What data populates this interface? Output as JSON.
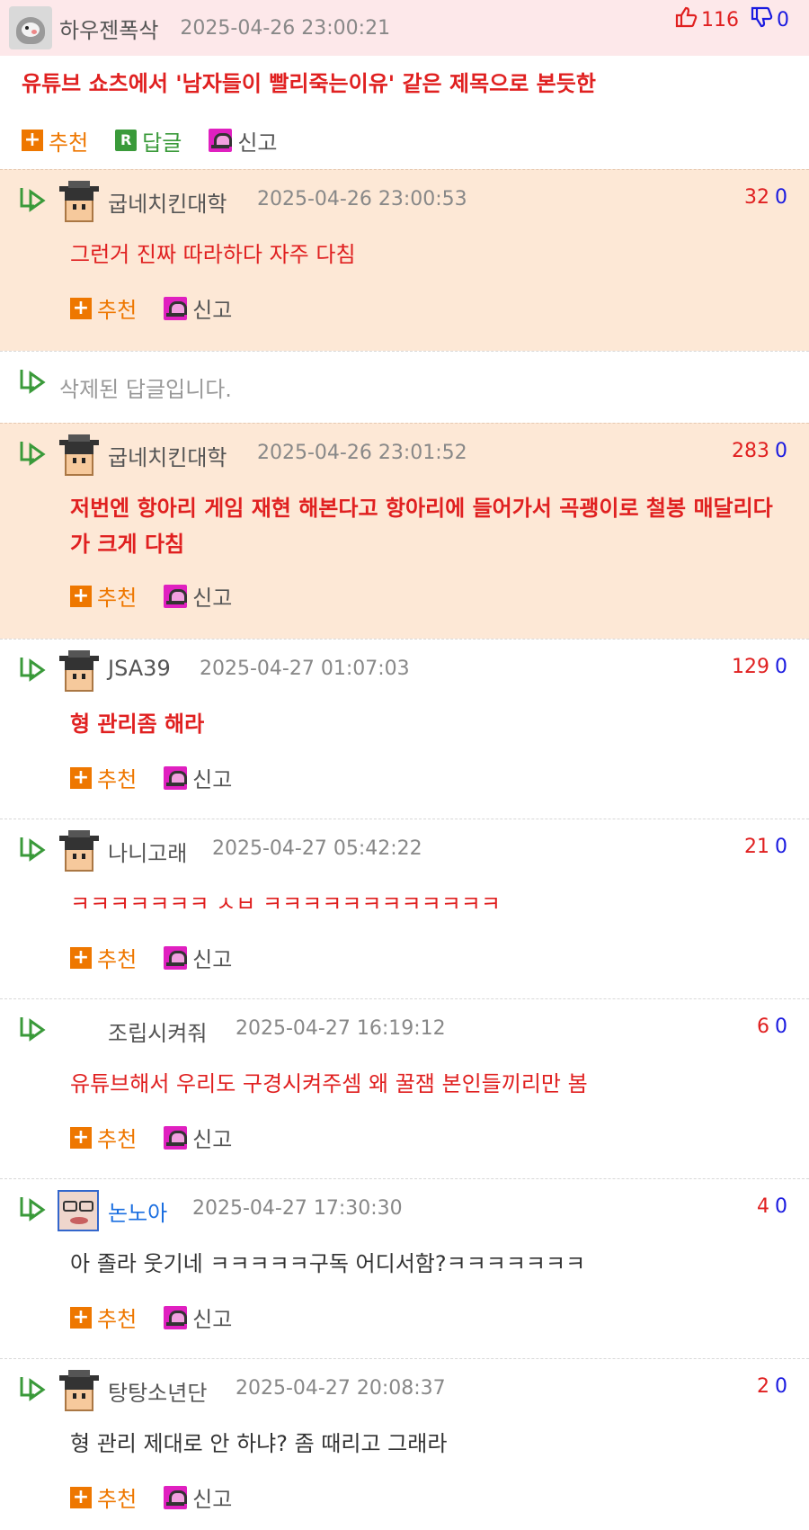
{
  "post": {
    "nickname": "하우젠폭삭",
    "date": "2025-04-26 23:00:21",
    "upvotes": "116",
    "downvotes": "0",
    "body": "유튜브 쇼츠에서 '남자들이 빨리죽는이유' 같은 제목으로 본듯한",
    "actions": {
      "recommend": "추천",
      "reply_icon": "R",
      "reply": "답글",
      "report": "신고"
    }
  },
  "comments": [
    {
      "nickname": "굽네치킨대학",
      "date": "2025-04-26 23:00:53",
      "up": "32",
      "down": "0",
      "text": "그런거 진짜 따라하다 자주 다침",
      "recommend": "추천",
      "report": "신고"
    },
    {
      "deleted_text": "삭제된 답글입니다."
    },
    {
      "nickname": "굽네치킨대학",
      "date": "2025-04-26 23:01:52",
      "up": "283",
      "down": "0",
      "text": "저번엔 항아리 게임 재현 해본다고 항아리에 들어가서 곡괭이로 철봉 매달리다가 크게 다침",
      "recommend": "추천",
      "report": "신고"
    },
    {
      "nickname": "JSA39",
      "date": "2025-04-27 01:07:03",
      "up": "129",
      "down": "0",
      "text": "형 관리좀 해라",
      "recommend": "추천",
      "report": "신고"
    },
    {
      "nickname": "나니고래",
      "date": "2025-04-27 05:42:22",
      "up": "21",
      "down": "0",
      "text": "ㅋㅋㅋㅋㅋㅋㅋ ㅅㅂ ㅋㅋㅋㅋㅋㅋㅋㅋㅋㅋㅋㅋ",
      "recommend": "추천",
      "report": "신고"
    },
    {
      "nickname": "조립시켜줘",
      "date": "2025-04-27 16:19:12",
      "up": "6",
      "down": "0",
      "text": "유튜브해서 우리도 구경시켜주셈 왜 꿀잼 본인들끼리만 봄",
      "recommend": "추천",
      "report": "신고"
    },
    {
      "nickname": "논노아",
      "date": "2025-04-27 17:30:30",
      "up": "4",
      "down": "0",
      "text": "아 졸라 웃기네 ㅋㅋㅋㅋㅋ구독 어디서함?ㅋㅋㅋㅋㅋㅋㅋ",
      "recommend": "추천",
      "report": "신고"
    },
    {
      "nickname": "탕탕소년단",
      "date": "2025-04-27 20:08:37",
      "up": "2",
      "down": "0",
      "text": "형 관리 제대로 안 하냐? 좀 때리고 그래라",
      "recommend": "추천",
      "report": "신고"
    }
  ],
  "colors": {
    "accent_red": "#e02020",
    "accent_blue": "#1a1ae0",
    "highlight_bg": "#fde8d6",
    "post_bg": "#fde8ea"
  }
}
